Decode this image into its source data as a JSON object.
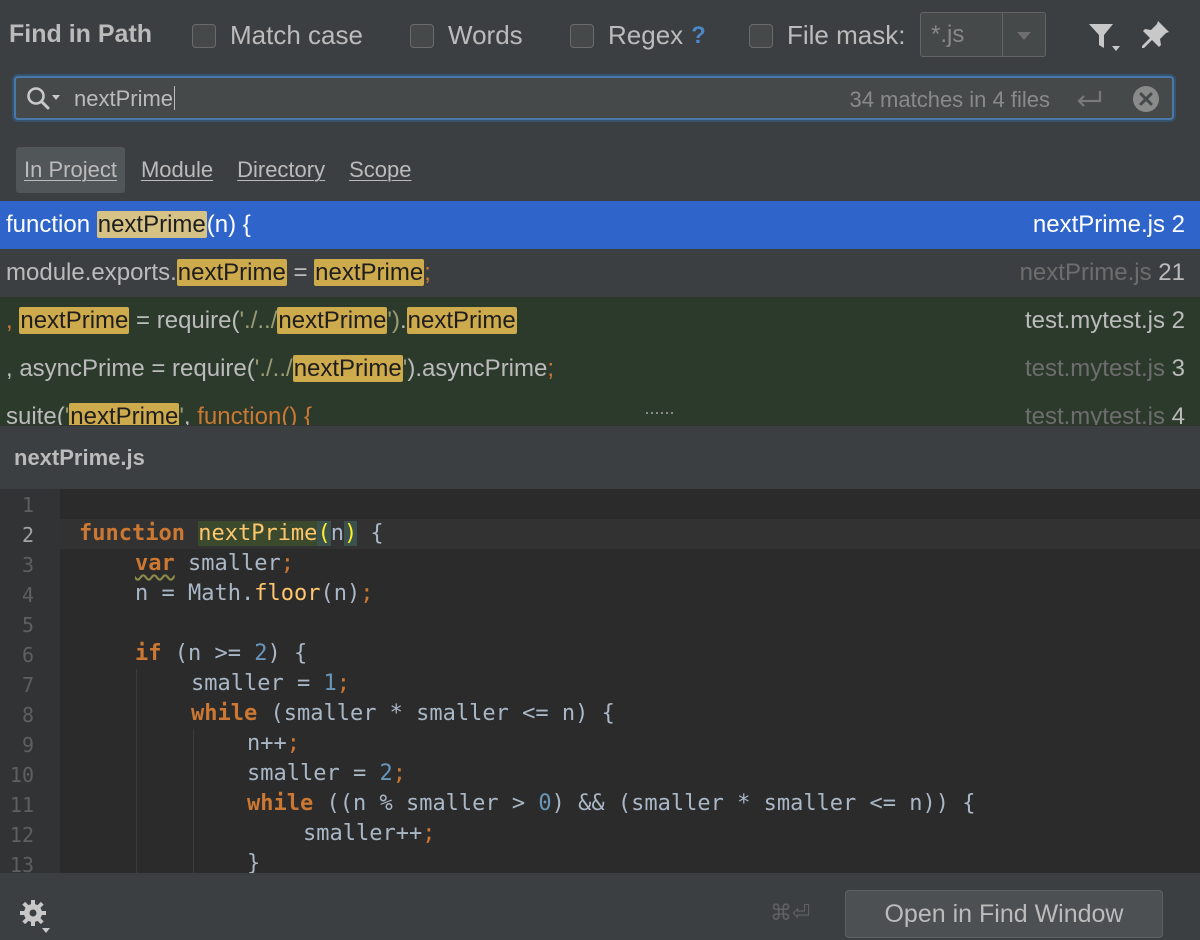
{
  "toolbar": {
    "title": "Find in Path",
    "options": {
      "match_case": "Match case",
      "words": "Words",
      "regex": "Regex",
      "regex_help": "?",
      "file_mask": "File mask:"
    },
    "file_mask_value": "*.js",
    "icons": {
      "filter": "filter-icon",
      "pin": "pin-icon"
    }
  },
  "search": {
    "value": "nextPrime",
    "match_count": "34 matches in 4 files"
  },
  "scope_tabs": [
    {
      "label": "In Project",
      "active": true
    },
    {
      "label": "Module",
      "active": false
    },
    {
      "label": "Directory",
      "active": false
    },
    {
      "label": "Scope",
      "active": false
    }
  ],
  "results": [
    {
      "file": "nextPrime.js",
      "line": "2",
      "parts": [
        "function ",
        "nextPrime",
        "(n) {"
      ]
    },
    {
      "file": "nextPrime.js",
      "line": "21",
      "parts": [
        "module.exports.",
        "nextPrime",
        " = ",
        "nextPrime",
        ";"
      ]
    },
    {
      "file": "test.mytest.js",
      "line": "2",
      "parts": [
        ", ",
        "nextPrime",
        " = require(",
        "'./../",
        "nextPrime",
        "')",
        ".",
        "nextPrime"
      ]
    },
    {
      "file": "test.mytest.js",
      "line": "3",
      "parts": [
        ", asyncPrime = require(",
        "'./../",
        "nextPrime",
        "'",
        ").asyncPrime",
        ";"
      ]
    },
    {
      "file": "test.mytest.js",
      "line": "4",
      "parts": [
        "suite(",
        "'",
        "nextPrime",
        "'",
        ", ",
        "function() {"
      ]
    }
  ],
  "preview": {
    "file_name": "nextPrime.js",
    "current_line": 2,
    "line_numbers": [
      "1",
      "2",
      "3",
      "4",
      "5",
      "6",
      "7",
      "8",
      "9",
      "10",
      "11",
      "12",
      "13"
    ],
    "code": {
      "l2": [
        "function",
        " ",
        "nextPrime",
        "(",
        "n",
        ")",
        " {"
      ],
      "l3": [
        "var",
        " smaller",
        ";"
      ],
      "l4": [
        "n = Math.",
        "floor",
        "(n)",
        ";"
      ],
      "l6": [
        "if",
        " (n >= ",
        "2",
        ") {"
      ],
      "l7": [
        "smaller = ",
        "1",
        ";"
      ],
      "l8": [
        "while",
        " (smaller * smaller <= n) {"
      ],
      "l9": [
        "n++",
        ";"
      ],
      "l10": [
        "smaller = ",
        "2",
        ";"
      ],
      "l11": [
        "while",
        " ((n % smaller > ",
        "0",
        ") && (smaller * smaller <= n)) {"
      ],
      "l12": [
        "smaller++",
        ";"
      ],
      "l13": [
        "}"
      ]
    }
  },
  "footer": {
    "shortcut": "⌘⏎",
    "open_button": "Open in Find Window"
  }
}
